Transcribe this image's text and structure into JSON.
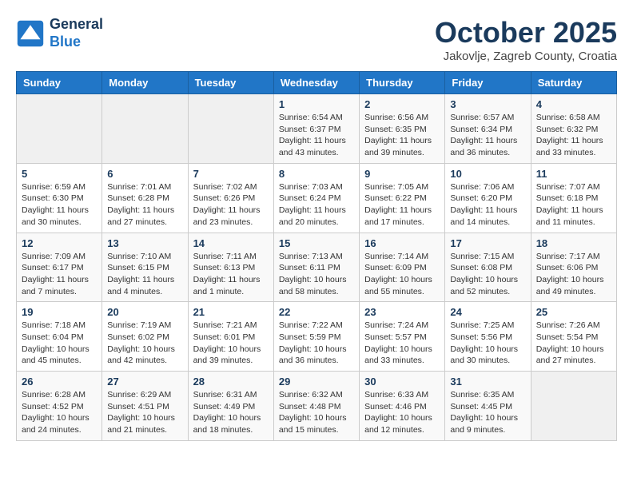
{
  "header": {
    "logo_line1": "General",
    "logo_line2": "Blue",
    "month": "October 2025",
    "location": "Jakovlje, Zagreb County, Croatia"
  },
  "weekdays": [
    "Sunday",
    "Monday",
    "Tuesday",
    "Wednesday",
    "Thursday",
    "Friday",
    "Saturday"
  ],
  "weeks": [
    [
      {
        "day": "",
        "info": ""
      },
      {
        "day": "",
        "info": ""
      },
      {
        "day": "",
        "info": ""
      },
      {
        "day": "1",
        "info": "Sunrise: 6:54 AM\nSunset: 6:37 PM\nDaylight: 11 hours\nand 43 minutes."
      },
      {
        "day": "2",
        "info": "Sunrise: 6:56 AM\nSunset: 6:35 PM\nDaylight: 11 hours\nand 39 minutes."
      },
      {
        "day": "3",
        "info": "Sunrise: 6:57 AM\nSunset: 6:34 PM\nDaylight: 11 hours\nand 36 minutes."
      },
      {
        "day": "4",
        "info": "Sunrise: 6:58 AM\nSunset: 6:32 PM\nDaylight: 11 hours\nand 33 minutes."
      }
    ],
    [
      {
        "day": "5",
        "info": "Sunrise: 6:59 AM\nSunset: 6:30 PM\nDaylight: 11 hours\nand 30 minutes."
      },
      {
        "day": "6",
        "info": "Sunrise: 7:01 AM\nSunset: 6:28 PM\nDaylight: 11 hours\nand 27 minutes."
      },
      {
        "day": "7",
        "info": "Sunrise: 7:02 AM\nSunset: 6:26 PM\nDaylight: 11 hours\nand 23 minutes."
      },
      {
        "day": "8",
        "info": "Sunrise: 7:03 AM\nSunset: 6:24 PM\nDaylight: 11 hours\nand 20 minutes."
      },
      {
        "day": "9",
        "info": "Sunrise: 7:05 AM\nSunset: 6:22 PM\nDaylight: 11 hours\nand 17 minutes."
      },
      {
        "day": "10",
        "info": "Sunrise: 7:06 AM\nSunset: 6:20 PM\nDaylight: 11 hours\nand 14 minutes."
      },
      {
        "day": "11",
        "info": "Sunrise: 7:07 AM\nSunset: 6:18 PM\nDaylight: 11 hours\nand 11 minutes."
      }
    ],
    [
      {
        "day": "12",
        "info": "Sunrise: 7:09 AM\nSunset: 6:17 PM\nDaylight: 11 hours\nand 7 minutes."
      },
      {
        "day": "13",
        "info": "Sunrise: 7:10 AM\nSunset: 6:15 PM\nDaylight: 11 hours\nand 4 minutes."
      },
      {
        "day": "14",
        "info": "Sunrise: 7:11 AM\nSunset: 6:13 PM\nDaylight: 11 hours\nand 1 minute."
      },
      {
        "day": "15",
        "info": "Sunrise: 7:13 AM\nSunset: 6:11 PM\nDaylight: 10 hours\nand 58 minutes."
      },
      {
        "day": "16",
        "info": "Sunrise: 7:14 AM\nSunset: 6:09 PM\nDaylight: 10 hours\nand 55 minutes."
      },
      {
        "day": "17",
        "info": "Sunrise: 7:15 AM\nSunset: 6:08 PM\nDaylight: 10 hours\nand 52 minutes."
      },
      {
        "day": "18",
        "info": "Sunrise: 7:17 AM\nSunset: 6:06 PM\nDaylight: 10 hours\nand 49 minutes."
      }
    ],
    [
      {
        "day": "19",
        "info": "Sunrise: 7:18 AM\nSunset: 6:04 PM\nDaylight: 10 hours\nand 45 minutes."
      },
      {
        "day": "20",
        "info": "Sunrise: 7:19 AM\nSunset: 6:02 PM\nDaylight: 10 hours\nand 42 minutes."
      },
      {
        "day": "21",
        "info": "Sunrise: 7:21 AM\nSunset: 6:01 PM\nDaylight: 10 hours\nand 39 minutes."
      },
      {
        "day": "22",
        "info": "Sunrise: 7:22 AM\nSunset: 5:59 PM\nDaylight: 10 hours\nand 36 minutes."
      },
      {
        "day": "23",
        "info": "Sunrise: 7:24 AM\nSunset: 5:57 PM\nDaylight: 10 hours\nand 33 minutes."
      },
      {
        "day": "24",
        "info": "Sunrise: 7:25 AM\nSunset: 5:56 PM\nDaylight: 10 hours\nand 30 minutes."
      },
      {
        "day": "25",
        "info": "Sunrise: 7:26 AM\nSunset: 5:54 PM\nDaylight: 10 hours\nand 27 minutes."
      }
    ],
    [
      {
        "day": "26",
        "info": "Sunrise: 6:28 AM\nSunset: 4:52 PM\nDaylight: 10 hours\nand 24 minutes."
      },
      {
        "day": "27",
        "info": "Sunrise: 6:29 AM\nSunset: 4:51 PM\nDaylight: 10 hours\nand 21 minutes."
      },
      {
        "day": "28",
        "info": "Sunrise: 6:31 AM\nSunset: 4:49 PM\nDaylight: 10 hours\nand 18 minutes."
      },
      {
        "day": "29",
        "info": "Sunrise: 6:32 AM\nSunset: 4:48 PM\nDaylight: 10 hours\nand 15 minutes."
      },
      {
        "day": "30",
        "info": "Sunrise: 6:33 AM\nSunset: 4:46 PM\nDaylight: 10 hours\nand 12 minutes."
      },
      {
        "day": "31",
        "info": "Sunrise: 6:35 AM\nSunset: 4:45 PM\nDaylight: 10 hours\nand 9 minutes."
      },
      {
        "day": "",
        "info": ""
      }
    ]
  ]
}
